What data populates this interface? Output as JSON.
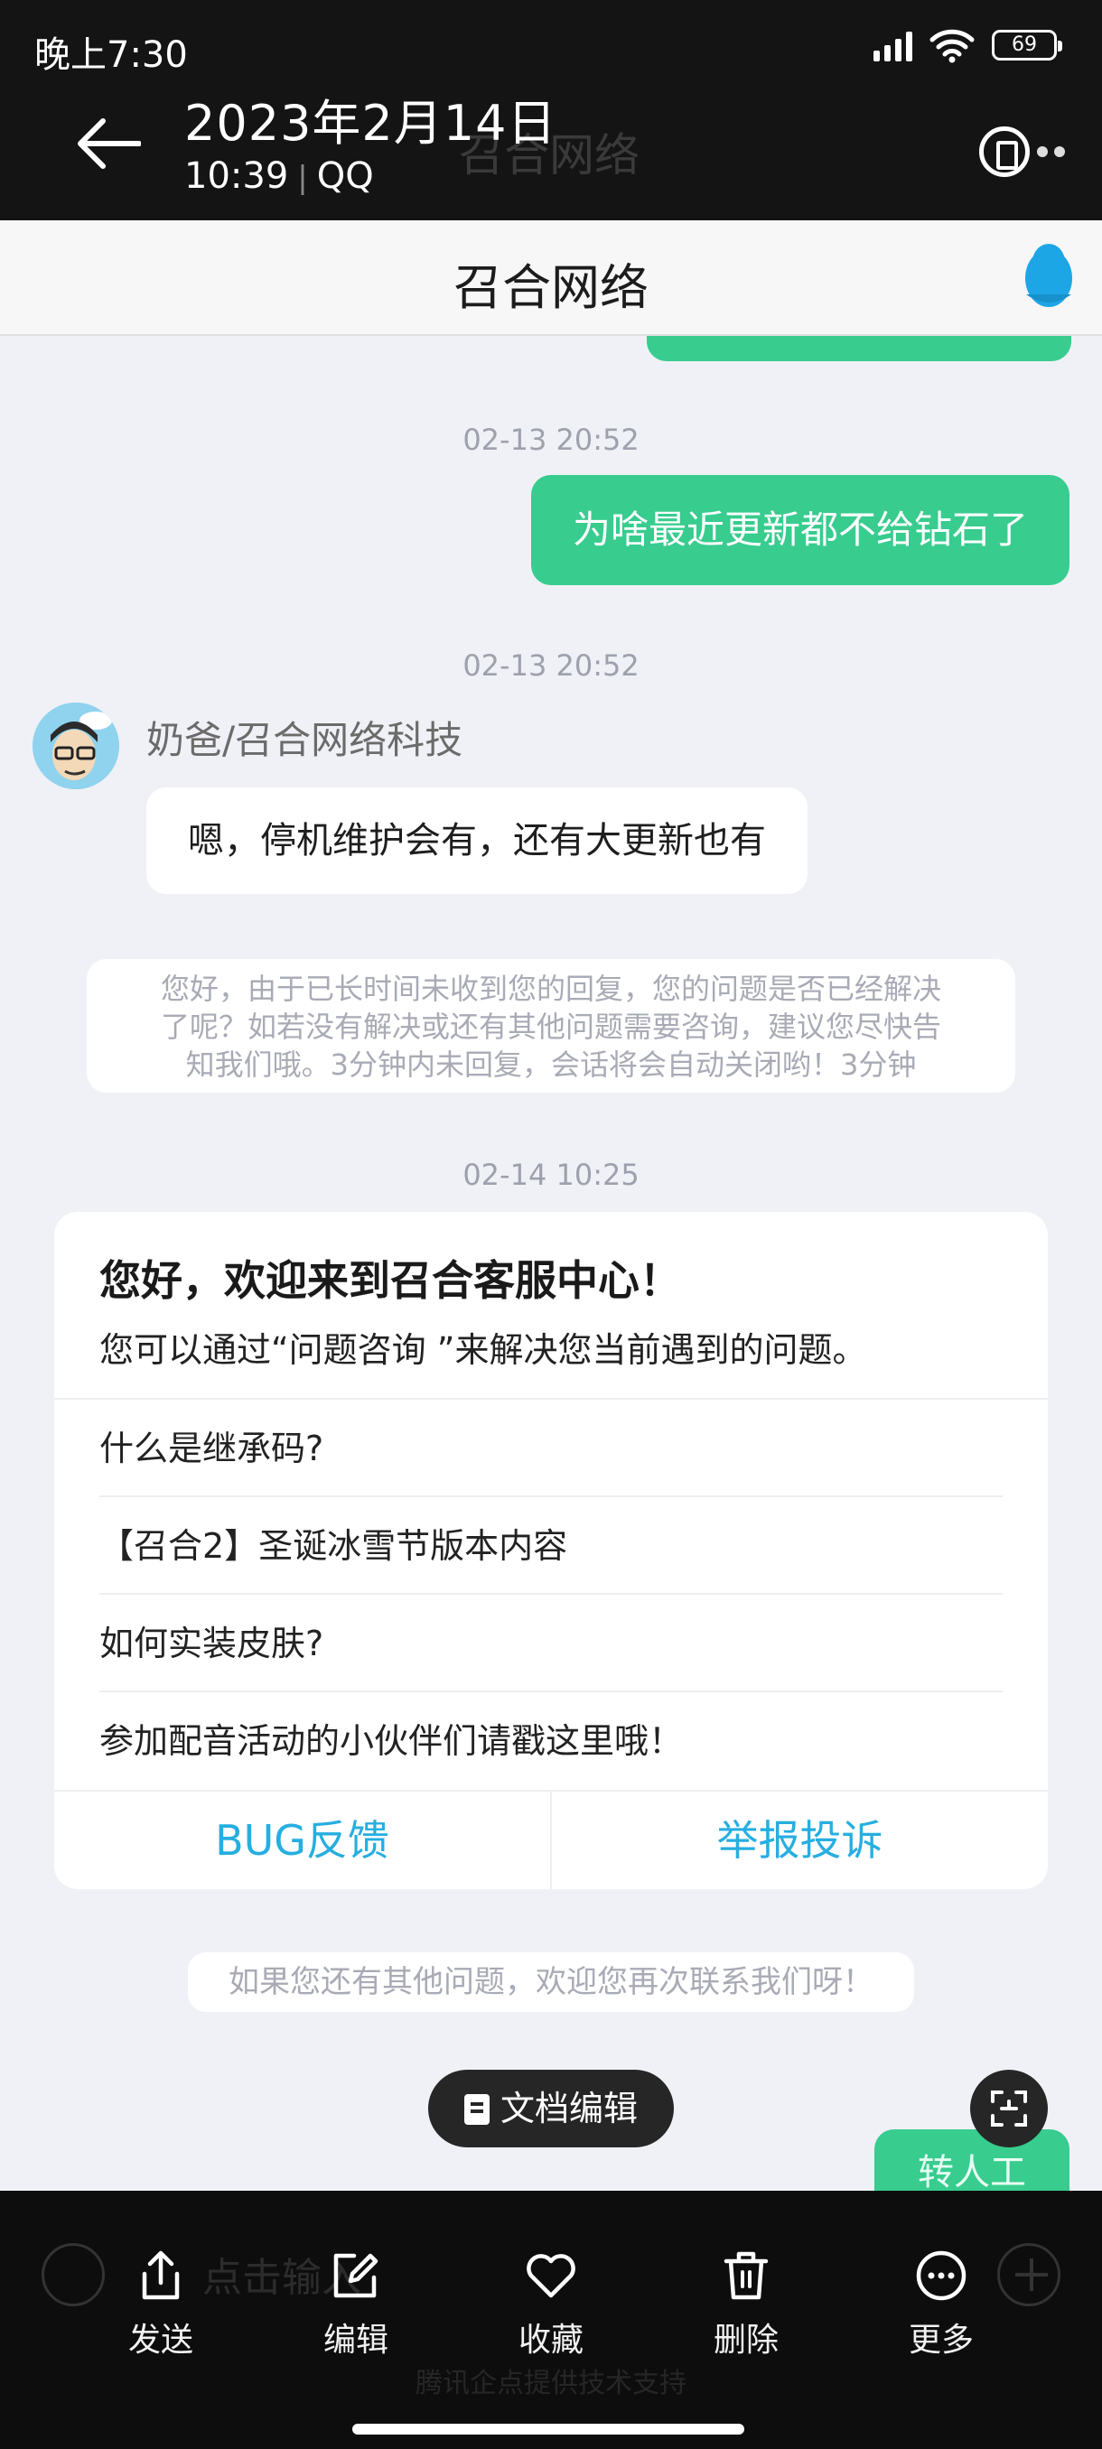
{
  "status_bar": {
    "time": "晚上7:30",
    "battery": "69"
  },
  "viewer": {
    "date": "2023年2月14日",
    "time": "10:39",
    "source": "QQ",
    "ghost_title": "召合网络"
  },
  "chat": {
    "title": "召合网络",
    "messages": {
      "t1": "02-13 20:52",
      "outgoing": "为啥最近更新都不给钻石了",
      "t2": "02-13 20:52",
      "sender": "奶爸/召合网络科技",
      "incoming": "嗯，停机维护会有，还有大更新也有",
      "system_note_lines": [
        "您好，由于已长时间未收到您的回复，您的问题是否已经解决",
        "了呢？如若没有解决或还有其他问题需要咨询，建议您尽快告",
        "知我们哦。3分钟内未回复，会话将会自动关闭哟！3分钟"
      ],
      "t3": "02-14 10:25"
    },
    "card": {
      "title": "您好，欢迎来到召合客服中心！",
      "subtitle": "您可以通过“问题咨询 ”来解决您当前遇到的问题。",
      "faqs": [
        "什么是继承码?",
        "【召合2】圣诞冰雪节版本内容",
        "如何实装皮肤?",
        "参加配音活动的小伙伴们请戳这里哦！"
      ],
      "actions": [
        "BUG反馈",
        "举报投诉"
      ]
    },
    "closing_note": "如果您还有其他问题，欢迎您再次联系我们呀！",
    "transfer_label": "转人工"
  },
  "floating": {
    "doc_edit": "文档编辑"
  },
  "ghost_bottom": {
    "input_placeholder": "点击输入",
    "footer": "腾讯企点提供技术支持"
  },
  "actions": [
    {
      "label": "发送",
      "icon": "share-icon"
    },
    {
      "label": "编辑",
      "icon": "edit-icon"
    },
    {
      "label": "收藏",
      "icon": "heart-icon"
    },
    {
      "label": "删除",
      "icon": "trash-icon"
    },
    {
      "label": "更多",
      "icon": "more-icon"
    }
  ],
  "colors": {
    "accent_green": "#38cc8f",
    "link_blue": "#26aee0",
    "dark_bar": "#141414"
  }
}
